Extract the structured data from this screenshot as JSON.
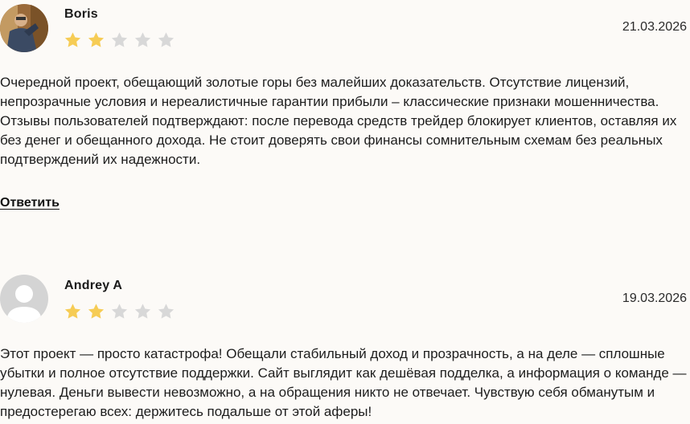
{
  "reviews": [
    {
      "author": "Boris",
      "date": "21.03.2026",
      "rating": 2,
      "rating_max": 5,
      "avatar": "user-photo",
      "text": "Очередной проект, обещающий золотые горы без малейших доказательств. Отсутствие лицензий, непрозрачные условия и нереалистичные гарантии прибыли – классические признаки мошенничества. Отзывы пользователей подтверждают: после перевода средств трейдер блокирует клиентов, оставляя их без денег и обещанного дохода. Не стоит доверять свои финансы сомнительным схемам без реальных подтверждений их надежности.",
      "reply_label": "Ответить"
    },
    {
      "author": "Andrey A",
      "date": "19.03.2026",
      "rating": 2,
      "rating_max": 5,
      "avatar": "default-avatar",
      "text": "Этот проект — просто катастрофа! Обещали стабильный доход и прозрачность, а на деле — сплошные убытки и полное отсутствие поддержки. Сайт выглядит как дешёвая подделка, а информация о команде — нулевая. Деньги вывести невозможно, а на обращения никто не отвечает. Чувствую себя обманутым и предостерегаю всех: держитесь подальше от этой аферы!"
    }
  ],
  "colors": {
    "star_filled": "#f6cc55",
    "star_empty": "#d8d8d8",
    "background": "#fcfaf7"
  }
}
